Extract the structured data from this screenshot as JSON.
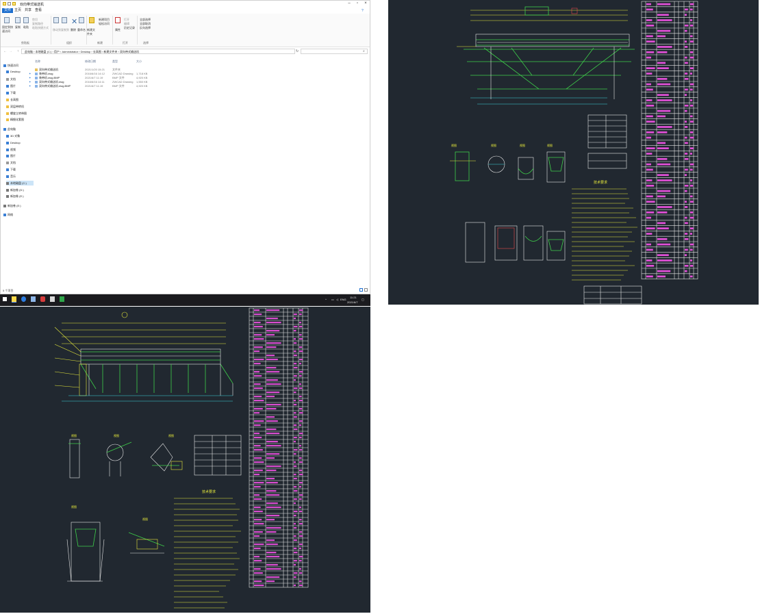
{
  "explorer": {
    "title": "双向带式输送机",
    "ribbon_tabs": [
      "文件",
      "主页",
      "共享",
      "查看"
    ],
    "ribbon_groups": {
      "clipboard": {
        "label": "剪贴板",
        "buttons": [
          "固定到快速访问",
          "复制",
          "粘贴",
          "剪切",
          "复制路径",
          "粘贴快捷方式"
        ]
      },
      "organize": {
        "label": "组织",
        "buttons": [
          "移动到",
          "复制到",
          "删除",
          "重命名"
        ]
      },
      "new": {
        "label": "新建",
        "buttons": [
          "新建文件夹",
          "新建项目",
          "轻松访问"
        ]
      },
      "open": {
        "label": "打开",
        "buttons": [
          "属性",
          "打开",
          "编辑",
          "历史记录"
        ]
      },
      "select": {
        "label": "选择",
        "buttons": [
          "全部选择",
          "全部取消",
          "反向选择"
        ]
      }
    },
    "breadcrumb": [
      "此电脑",
      "本地磁盘 (C:)",
      "用户",
      "Administrator",
      "Desktop",
      "长高图",
      "新建文件夹",
      "双向带式输送机"
    ],
    "nav_quick": [
      "快速访问",
      "Desktop",
      "文档",
      "图片",
      "下载",
      "长高图",
      "双层带转机",
      "螺旋立转带图",
      "精细化套图"
    ],
    "nav_pc": [
      "此电脑",
      "3D 对象",
      "Desktop",
      "视频",
      "图片",
      "文档",
      "下载",
      "音乐",
      "本地磁盘 (C:)",
      "新加卷 (D:)",
      "新加卷 (E:)"
    ],
    "nav_other": [
      "新加卷 (E:)",
      "网络"
    ],
    "columns": [
      "名称",
      "修改日期",
      "类型",
      "大小"
    ],
    "files": [
      {
        "name": "双向带式输送机",
        "date": "2021/1/20 15:21",
        "type": "文件夹",
        "size": "",
        "kind": "folder"
      },
      {
        "name": "装带机.dwg",
        "date": "2016/6/16 14:12",
        "type": "ZWCAD Drawing",
        "size": "1,718 KB",
        "kind": "doc"
      },
      {
        "name": "装带机.dwg.BMP",
        "date": "2021/6/7 11:19",
        "type": "BMP 文件",
        "size": "4,920 KB",
        "kind": "doc"
      },
      {
        "name": "双向带式输送机.dwg",
        "date": "2016/6/16 14:11",
        "type": "ZWCAD Drawing",
        "size": "1,550 KB",
        "kind": "doc"
      },
      {
        "name": "双向带式输送机.dwg.BMP",
        "date": "2021/6/7 11:19",
        "type": "BMP 文件",
        "size": "4,920 KB",
        "kind": "doc"
      }
    ],
    "status": "5 个项目"
  },
  "taskbar": {
    "lang": "ENG",
    "time": "11:21",
    "date": "2021/6/7"
  }
}
